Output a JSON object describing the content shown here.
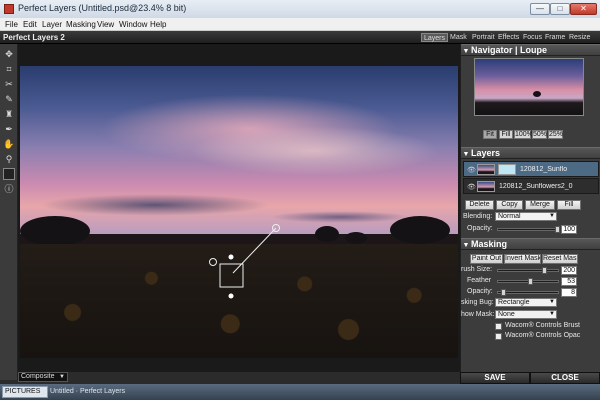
{
  "window": {
    "title": "Perfect Layers (Untitled.psd@23.4% 8 bit)",
    "min": "—",
    "max": "□",
    "close": "✕"
  },
  "menu": [
    "File",
    "Edit",
    "Layer",
    "Masking",
    "View",
    "Window",
    "Help"
  ],
  "app": {
    "logo": "Perfect Layers 2",
    "modules": [
      "Layers",
      "Mask",
      "Portrait",
      "Effects",
      "Focus",
      "Frame",
      "Resize"
    ],
    "active_module": "Layers"
  },
  "tools": [
    "move-icon",
    "crop-icon",
    "transform-icon",
    "brush-icon",
    "masking-brush-icon",
    "pen-icon",
    "hand-icon",
    "zoom-icon",
    "swatch-icon",
    "info-icon"
  ],
  "canvas": {
    "view_select": "Composite"
  },
  "navigator": {
    "title": "Navigator | Loupe",
    "zoom_buttons": [
      "Fit",
      "Fill",
      "100%",
      "50%",
      "25%"
    ]
  },
  "layers": {
    "title": "Layers",
    "items": [
      {
        "name": "120812_Sunflo"
      },
      {
        "name": "120812_Sunflowers2_0"
      }
    ],
    "actions": [
      "Delete",
      "Copy",
      "Merge",
      "Fill"
    ],
    "blending_label": "Blending:",
    "blending_value": "Normal",
    "opacity_label": "Opacity:",
    "opacity_value": "100"
  },
  "masking": {
    "title": "Masking",
    "actions": [
      "Paint Out",
      "Invert Mask",
      "Reset Mask"
    ],
    "brush_size_label": "rush Size:",
    "brush_size_value": "200",
    "feather_label": "Feather",
    "feather_value": "53",
    "opacity_label": "Opacity:",
    "opacity_value": "8",
    "bug_label": "sking Bug:",
    "bug_value": "Rectangle",
    "show_mask_label": "how Mask:",
    "show_mask_value": "None",
    "wacom1": "Wacom® Controls Brust",
    "wacom2": "Wacom® Controls Opac"
  },
  "footer": {
    "save": "SAVE",
    "close": "CLOSE"
  },
  "taskbar": {
    "item1": "PICTURES",
    "item2": "Untitled · Perfect Layers"
  }
}
